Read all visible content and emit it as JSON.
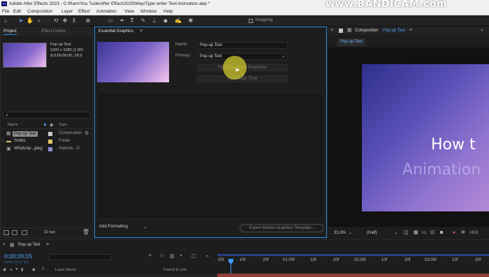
{
  "app": {
    "logo": "Ae",
    "title": "Adobe After Effects 2023 - C:\\Ram\\You Tude\\After Effact\\2025\\May\\Type writer Text Animation.aep *",
    "watermark": "www.BANDICAM.com"
  },
  "menu": [
    "File",
    "Edit",
    "Composition",
    "Layer",
    "Effect",
    "Animation",
    "View",
    "Window",
    "Help"
  ],
  "toolbar": {
    "snapping_label": "Snapping",
    "tools": [
      "home-icon",
      "selection-icon",
      "hand-icon",
      "zoom-icon",
      "orbit-icon",
      "track-xy-icon",
      "track-z-icon",
      "pan-behind-icon",
      "rectangle-icon",
      "pen-icon",
      "type-icon",
      "brush-icon",
      "clone-stamp-icon",
      "eraser-icon",
      "roto-brush-icon",
      "puppet-pin-icon"
    ]
  },
  "project": {
    "tab_label": "Project",
    "tab2_label": "Effect Contro",
    "selected_name": "Pop up Text",
    "selected_info_1": "1920 x 1080 (1.00)",
    "selected_info_2": "Δ 0;00;06;00, 29.9",
    "headers": {
      "name": "Name",
      "type": "Type"
    },
    "items": [
      {
        "name": "Pop up Text",
        "type": "Composition",
        "color": "#c9c9c9"
      },
      {
        "name": "Solids",
        "type": "Folder",
        "color": "#e3c66b"
      },
      {
        "name": "WhatsAp...jpeg",
        "type": "Importe...G",
        "color": "#8c8cd0"
      }
    ],
    "bpc": "32 bpc"
  },
  "essential_graphics": {
    "tab_label": "Essential Graphics",
    "name_label": "Name:",
    "name_value": "Pop-up  Text",
    "primary_label": "Primary:",
    "primary_value": "Pop up Text",
    "solo_button": "Solo Supported Properties",
    "poster_button": "Set Poster Time",
    "add_formatting": "Add Formatting",
    "export_button": "Export Motion Graphics Template..."
  },
  "composition": {
    "tab_label": "Composition",
    "tab_name": "Pop up Text",
    "sub_tab": "Pop up Text",
    "text_line1": "How t",
    "text_line2": "Animation",
    "zoom": "33.3%",
    "resolution": "(Half)",
    "extra_value": "+0.0"
  },
  "timeline": {
    "tab_label": "Pop up Text",
    "timecode": "0;00;00;05",
    "fps": "00005 (29.97 fps)",
    "layer_name_header": "Layer Name",
    "parent_header": "Parent & Link",
    "ruler_ticks": [
      "00f",
      "10f",
      "20f",
      "01:00f",
      "10f",
      "20f",
      "02:00f",
      "10f",
      "20f",
      "03:00f",
      "10f",
      "20f"
    ]
  }
}
